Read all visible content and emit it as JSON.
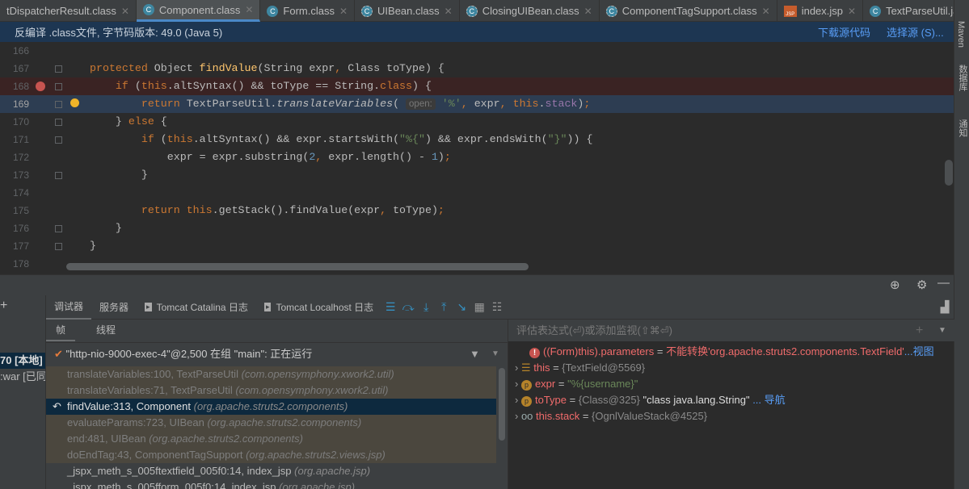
{
  "tabs": [
    {
      "label": "tDispatcherResult.class",
      "icon": "none"
    },
    {
      "label": "Component.class",
      "icon": "class",
      "active": true
    },
    {
      "label": "Form.class",
      "icon": "class"
    },
    {
      "label": "UIBean.class",
      "icon": "abstract-class"
    },
    {
      "label": "ClosingUIBean.class",
      "icon": "abstract-class"
    },
    {
      "label": "ComponentTagSupport.class",
      "icon": "abstract-class"
    },
    {
      "label": "index.jsp",
      "icon": "jsp"
    },
    {
      "label": "TextParseUtil.java",
      "icon": "class"
    }
  ],
  "banner": {
    "text": "反编译 .class文件, 字节码版本: 49.0 (Java 5)",
    "download": "下载源代码",
    "choose": "选择源 (S)..."
  },
  "right_bar": {
    "maven": "Maven",
    "database": "数据库",
    "notify": "通知"
  },
  "code": [
    {
      "n": "166",
      "t": []
    },
    {
      "n": "167",
      "t": [
        [
          "kw",
          "protected "
        ],
        [
          "",
          "Object "
        ],
        [
          "fn",
          "findValue"
        ],
        [
          "",
          "(String expr"
        ],
        [
          "kw",
          ", "
        ],
        [
          "",
          "Class toType) {"
        ]
      ]
    },
    {
      "n": "168",
      "bp": true,
      "t": [
        [
          "",
          "    "
        ],
        [
          "kw",
          "if "
        ],
        [
          "",
          "("
        ],
        [
          "kw",
          "this"
        ],
        [
          "",
          ".altSyntax() && toType == String."
        ],
        [
          "kw",
          "class"
        ],
        [
          "",
          ") {"
        ]
      ]
    },
    {
      "n": "169",
      "cur": true,
      "t": [
        [
          "",
          "        "
        ],
        [
          "kw",
          "return "
        ],
        [
          "",
          "TextParseUtil."
        ],
        [
          "it",
          "translateVariables"
        ],
        [
          "",
          "( "
        ],
        [
          "hint",
          "open:"
        ],
        [
          "st",
          " '%'"
        ],
        [
          "kw",
          ", "
        ],
        [
          "",
          "expr"
        ],
        [
          "kw",
          ", "
        ],
        [
          "kw",
          "this"
        ],
        [
          "",
          "."
        ],
        [
          "fl",
          "stack"
        ],
        [
          "",
          ")"
        ],
        [
          "kw",
          ";"
        ]
      ]
    },
    {
      "n": "170",
      "t": [
        [
          "",
          "    } "
        ],
        [
          "kw",
          "else "
        ],
        [
          "",
          "{"
        ]
      ]
    },
    {
      "n": "171",
      "t": [
        [
          "",
          "        "
        ],
        [
          "kw",
          "if "
        ],
        [
          "",
          "("
        ],
        [
          "kw",
          "this"
        ],
        [
          "",
          ".altSyntax() && expr.startsWith("
        ],
        [
          "st",
          "\"%{\""
        ],
        [
          "",
          ") && expr.endsWith("
        ],
        [
          "st",
          "\"}\""
        ],
        [
          "",
          ")) {"
        ]
      ]
    },
    {
      "n": "172",
      "t": [
        [
          "",
          "            expr = expr.substring("
        ],
        [
          "num",
          "2"
        ],
        [
          "kw",
          ", "
        ],
        [
          "",
          "expr.length() - "
        ],
        [
          "num",
          "1"
        ],
        [
          "",
          ")"
        ],
        [
          "kw",
          ";"
        ]
      ]
    },
    {
      "n": "173",
      "t": [
        [
          "",
          "        }"
        ]
      ]
    },
    {
      "n": "174",
      "t": []
    },
    {
      "n": "175",
      "t": [
        [
          "",
          "        "
        ],
        [
          "kw",
          "return this"
        ],
        [
          "",
          ".getStack().findValue(expr"
        ],
        [
          "kw",
          ", "
        ],
        [
          "",
          "toType)"
        ],
        [
          "kw",
          ";"
        ]
      ]
    },
    {
      "n": "176",
      "t": [
        [
          "",
          "    }"
        ]
      ]
    },
    {
      "n": "177",
      "t": [
        [
          "",
          "}"
        ]
      ]
    },
    {
      "n": "178",
      "t": []
    }
  ],
  "debug": {
    "tabs": [
      {
        "label": "调试器",
        "active": true
      },
      {
        "label": "服务器"
      },
      {
        "label": "Tomcat Catalina 日志"
      },
      {
        "label": "Tomcat Localhost 日志"
      }
    ],
    "subtabs": [
      "帧",
      "线程"
    ],
    "left_strip": [
      "70 [本地]",
      ":war [已同"
    ],
    "thread": "\"http-nio-9000-exec-4\"@2,500 在组 \"main\": 正在运行",
    "frames": [
      {
        "m": "translateVariables:100, TextParseUtil",
        "p": "(com.opensymphony.xwork2.util)",
        "k": "lib"
      },
      {
        "m": "translateVariables:71, TextParseUtil",
        "p": "(com.opensymphony.xwork2.util)",
        "k": "lib"
      },
      {
        "m": "findValue:313, Component",
        "p": "(org.apache.struts2.components)",
        "k": "sel"
      },
      {
        "m": "evaluateParams:723, UIBean",
        "p": "(org.apache.struts2.components)",
        "k": "lib"
      },
      {
        "m": "end:481, UIBean",
        "p": "(org.apache.struts2.components)",
        "k": "lib"
      },
      {
        "m": "doEndTag:43, ComponentTagSupport",
        "p": "(org.apache.struts2.views.jsp)",
        "k": "lib"
      },
      {
        "m": "_jspx_meth_s_005ftextfield_005f0:14, index_jsp",
        "p": "(org.apache.jsp)",
        "k": "norm"
      },
      {
        "m": "_jspx_meth_s_005fform_005f0:14, index_jsp",
        "p": "(org.apache.jsp)",
        "k": "norm"
      }
    ],
    "eval_placeholder": "评估表达式(⏎)或添加监视(⇧⌘⏎)",
    "vars": [
      {
        "icon": "error",
        "name": "((Form)this).parameters",
        "eq": " = ",
        "val": "不能转换'org.apache.struts2.components.TextField'",
        "link": "...视图"
      },
      {
        "icon": "field",
        "name": "this",
        "eq": " = ",
        "val": "{TextField@5569}"
      },
      {
        "icon": "param",
        "name": "expr",
        "eq": " = ",
        "str": "\"%{username}\""
      },
      {
        "icon": "param",
        "name": "toType",
        "eq": " = ",
        "val": "{Class@325}",
        "str2": " \"class java.lang.String\"",
        "link": " ... 导航"
      },
      {
        "icon": "watch",
        "name": "this.stack",
        "eq": " = ",
        "val": "{OgnlValueStack@4525}"
      }
    ]
  }
}
